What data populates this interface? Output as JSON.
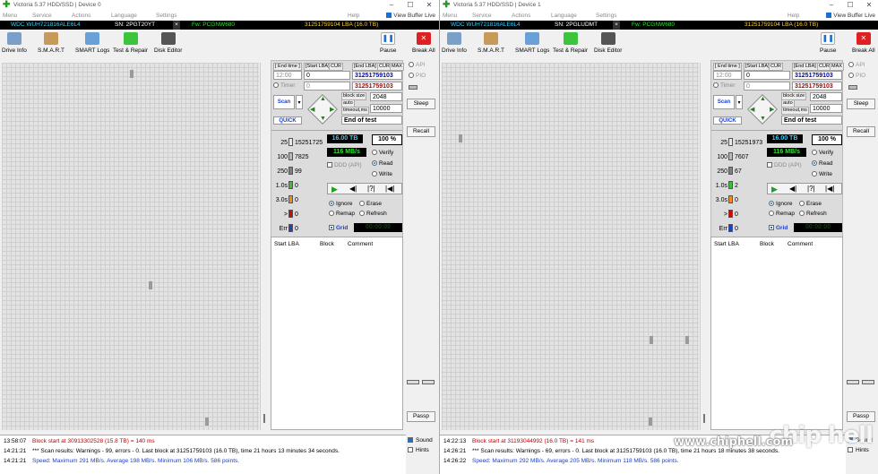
{
  "menu": [
    "Menu",
    "Service",
    "Actions",
    "Language",
    "Settings",
    "Help"
  ],
  "view_buffer_live": "View Buffer Live",
  "toolbar": {
    "drive_info": "Drive Info",
    "smart": "S.M.A.R.T",
    "smart_logs": "SMART Logs",
    "test_repair": "Test & Repair",
    "disk_editor": "Disk Editor",
    "pause": "Pause",
    "break_all": "Break All"
  },
  "labels": {
    "end_time": "[ End time ]",
    "start_lba": "[Start LBA]",
    "cur": "CUR",
    "end_lba": "[End LBA]",
    "max": "MAX",
    "timer": "Timer",
    "block_size": "block size",
    "auto": "auto",
    "timeout": "timeout,ms",
    "end_of_test": "End of test",
    "scan": "Scan",
    "quick": "QUICK",
    "ddd": "DDD (API)",
    "verify": "Verify",
    "read": "Read",
    "write": "Write",
    "ignore": "Ignore",
    "erase": "Erase",
    "remap": "Remap",
    "refresh": "Refresh",
    "grid": "Grid",
    "grid_time": "00:00:00",
    "api": "API",
    "pio": "PIO",
    "sleep": "Sleep",
    "recall": "Recall",
    "passp": "Passp",
    "start_lba_col": "Start LBA",
    "block_col": "Block",
    "comment_col": "Comment",
    "sound": "Sound",
    "hints": "Hints",
    "err_x": "Err"
  },
  "thresholds": [
    "25",
    "100",
    "250",
    "1.0s",
    "3.0s",
    ">",
    "Err"
  ],
  "windows": [
    {
      "title": "Victoria 5.37 HDD/SSD | Device 0",
      "model": "WDC   WUH721816ALE6L4",
      "serial": "SN: 2PGT20YT",
      "firmware": "Fw: PCGNW680",
      "lba_info": "31251759104 LBA (16.0 TB)",
      "end_time": "12:00",
      "start_lba": "0",
      "timer": "0",
      "end_lba": "31251759103",
      "end_lba_max": "31251759103",
      "block_size": "2048",
      "timeout": "10000",
      "capacity": "16.00 TB",
      "percent": "100",
      "percent_sign": "%",
      "speed": "116 MB/s",
      "counts": [
        "15251725",
        "7825",
        "99",
        "0",
        "0",
        "0",
        "0"
      ],
      "log": [
        {
          "time": "13:58:07",
          "text": "Block start at 30913302528 (15.8 TB)  = 140 ms",
          "color": "#c00000"
        },
        {
          "time": "14:21:21",
          "text": "*** Scan results: Warnings - 99, errors - 0. Last block at 31251759103 (16.0 TB), time 21 hours 13 minutes 34 seconds.",
          "color": "#000000"
        },
        {
          "time": "14:21:21",
          "text": "Speed: Maximum 291 MB/s. Average 198 MB/s. Minimum 106 MB/s. 586 points.",
          "color": "#1a3fd1"
        }
      ]
    },
    {
      "title": "Victoria 5.37 HDD/SSD | Device 1",
      "model": "WDC   WUH721816ALE6L4",
      "serial": "SN: 2PGLUDMT",
      "firmware": "Fw: PCGNW680",
      "lba_info": "31251759104 LBA (16.0 TB)",
      "end_time": "12:00",
      "start_lba": "0",
      "timer": "0",
      "end_lba": "31251759103",
      "end_lba_max": "31251759103",
      "block_size": "2048",
      "timeout": "10000",
      "capacity": "16.00 TB",
      "percent": "100",
      "percent_sign": "%",
      "speed": "116 MB/s",
      "counts": [
        "15251973",
        "7607",
        "67",
        "2",
        "0",
        "0",
        "0"
      ],
      "log": [
        {
          "time": "14:22:13",
          "text": "Block start at 31193044992 (16.0 TB)  = 141 ms",
          "color": "#c00000"
        },
        {
          "time": "14:26:21",
          "text": "*** Scan results: Warnings - 69, errors - 0. Last block at 31251759103 (16.0 TB), time 21 hours 18 minutes 38 seconds.",
          "color": "#000000"
        },
        {
          "time": "14:26:22",
          "text": "Speed: Maximum 292 MB/s. Average 205 MB/s. Minimum 118 MB/s. 586 points.",
          "color": "#1a3fd1"
        }
      ]
    }
  ],
  "colors": {
    "t25": "#e8e8e8",
    "t100": "#b8b8b8",
    "t250": "#7f7f7f",
    "t1s": "#2ec82e",
    "t3s": "#ff8c00",
    "tgt": "#e00000",
    "terr": "#1a3fd1"
  },
  "watermark": {
    "logo": "chip hell",
    "url": "www.chiphell.com"
  }
}
